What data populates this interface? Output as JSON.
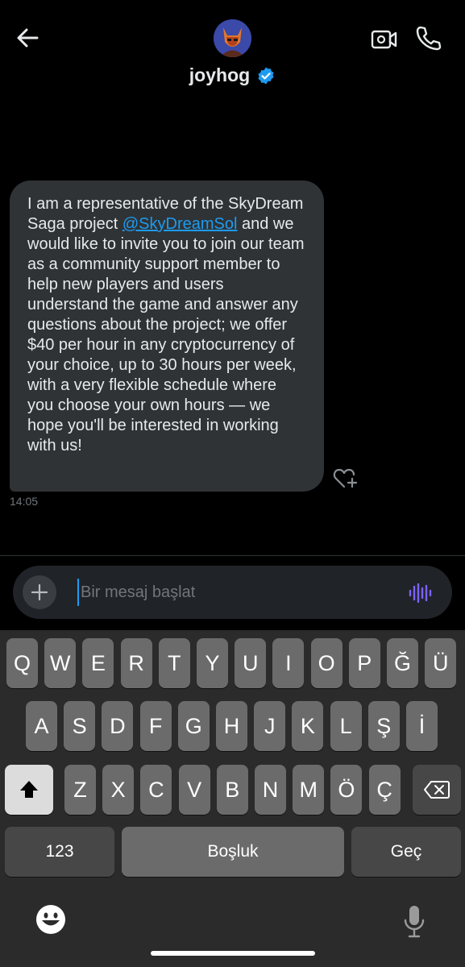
{
  "header": {
    "username": "joyhog"
  },
  "message": {
    "text_before": "I am a representative of the SkyDream Saga project ",
    "mention": "@SkyDreamSol",
    "text_after": " and we would like to invite you to join our team as a community support member to help new players and users understand the game and answer any questions about the project; we offer $40 per hour in any cryptocurrency of your choice, up to 30 hours per week, with a very flexible schedule where you choose your own hours — we hope you'll be interested in working with us!",
    "time": "14:05"
  },
  "composer": {
    "placeholder": "Bir mesaj başlat",
    "value": ""
  },
  "keyboard": {
    "row1": [
      "Q",
      "W",
      "E",
      "R",
      "T",
      "Y",
      "U",
      "I",
      "O",
      "P",
      "Ğ",
      "Ü"
    ],
    "row2": [
      "A",
      "S",
      "D",
      "F",
      "G",
      "H",
      "J",
      "K",
      "L",
      "Ş",
      "İ"
    ],
    "row3": [
      "Z",
      "X",
      "C",
      "V",
      "B",
      "N",
      "M",
      "Ö",
      "Ç"
    ],
    "numbers_label": "123",
    "space_label": "Boşluk",
    "return_label": "Geç"
  },
  "colors": {
    "accent": "#1d9bf0",
    "bubble": "#2f3336",
    "voice": "#7b61ff"
  }
}
